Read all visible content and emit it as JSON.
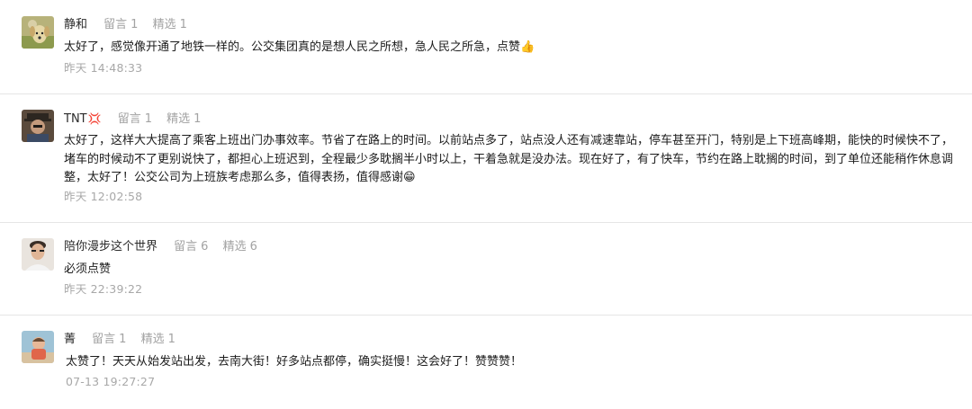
{
  "labels": {
    "liuyan": "留言",
    "jingxuan": "精选"
  },
  "comments": [
    {
      "nickname": "静和",
      "liuyan_count": "1",
      "jingxuan_count": "1",
      "text": "太好了，感觉像开通了地铁一样的。公交集团真的是想人民之所想，急人民之所急，点赞",
      "emoji": "👍",
      "time": "昨天 14:48:33"
    },
    {
      "nickname_lead": "",
      "nickname": "TNT",
      "nickname_emoji": "💢",
      "liuyan_count": "1",
      "jingxuan_count": "1",
      "text": "太好了，这样大大提高了乘客上班出门办事效率。节省了在路上的时间。以前站点多了，站点没人还有减速靠站，停车甚至开门，特别是上下班高峰期，能快的时候快不了，堵车的时候动不了更别说快了，都担心上班迟到，全程最少多耽搁半小时以上，干着急就是没办法。现在好了，有了快车，节约在路上耽搁的时间，到了单位还能稍作休息调整，太好了！公交公司为上班族考虑那么多，值得表扬，值得感谢",
      "emoji": "😁",
      "time": "昨天 12:02:58"
    },
    {
      "nickname": "陪你漫步这个世界",
      "liuyan_count": "6",
      "jingxuan_count": "6",
      "text": "必须点赞",
      "emoji": "",
      "time": "昨天 22:39:22"
    },
    {
      "nickname": "菁",
      "liuyan_count": "1",
      "jingxuan_count": "1",
      "text": "太赞了！天天从始发站出发，去南大街！好多站点都停，确实挺慢！这会好了！赞赞赞！",
      "emoji": "",
      "time": "07-13 19:27:27"
    }
  ]
}
